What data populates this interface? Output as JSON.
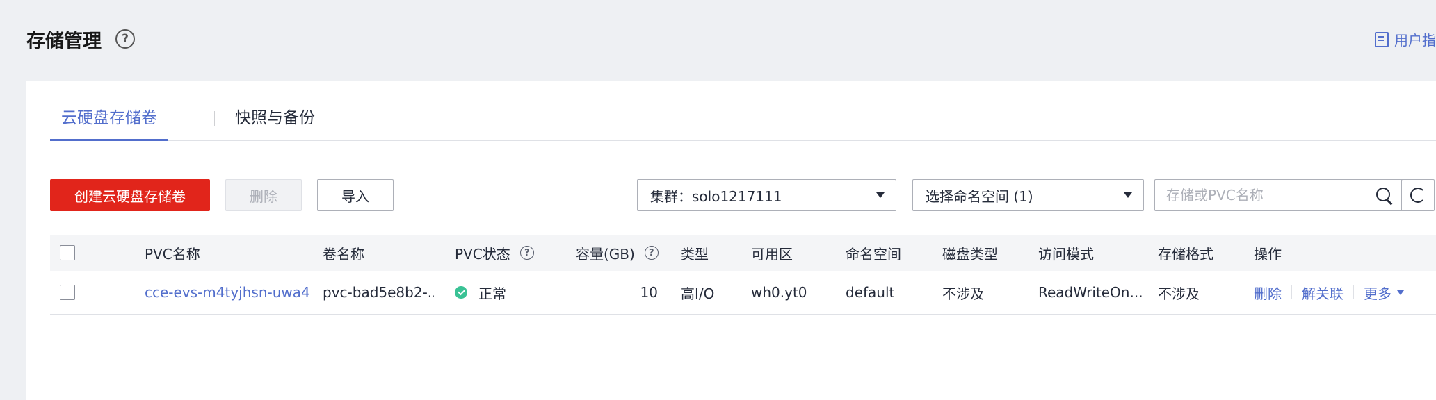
{
  "header": {
    "title": "存储管理",
    "help_icon": "question-circle-icon",
    "guide_label": "用户指"
  },
  "tabs": [
    {
      "label": "云硬盘存储卷",
      "active": true
    },
    {
      "label": "快照与备份",
      "active": false
    }
  ],
  "toolbar": {
    "create_label": "创建云硬盘存储卷",
    "delete_label": "删除",
    "import_label": "导入",
    "cluster_select": "集群：solo1217111",
    "namespace_select": "选择命名空间 (1)",
    "search_placeholder": "存储或PVC名称",
    "refresh_icon": "refresh-icon"
  },
  "table": {
    "columns": [
      "PVC名称",
      "卷名称",
      "PVC状态",
      "容量(GB)",
      "类型",
      "可用区",
      "命名空间",
      "磁盘类型",
      "访问模式",
      "存储格式",
      "操作"
    ],
    "rows": [
      {
        "pvc_name": "cce-evs-m4tyjhsn-uwa4",
        "volume_name": "pvc-bad5e8b2-...",
        "status": "正常",
        "capacity": "10",
        "type": "高I/O",
        "zone": "wh0.yt0",
        "namespace": "default",
        "disk_type": "不涉及",
        "access_mode": "ReadWriteOn...",
        "storage_format": "不涉及",
        "actions": {
          "delete": "删除",
          "unbind": "解关联",
          "more": "更多"
        }
      }
    ]
  },
  "colors": {
    "accent": "#526ecc",
    "primary_button": "#e1251b",
    "status_ok": "#3ac295"
  }
}
